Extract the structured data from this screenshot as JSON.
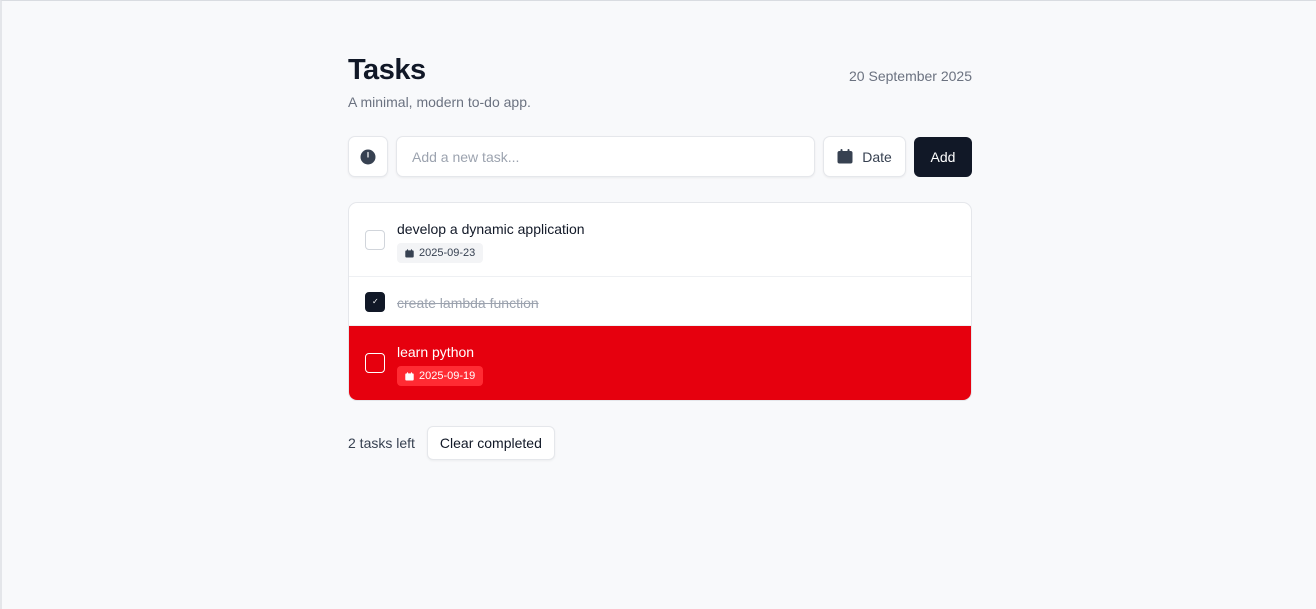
{
  "header": {
    "title": "Tasks",
    "subtitle": "A minimal, modern to-do app.",
    "today": "20 September 2025"
  },
  "composer": {
    "priority_icon": "clock-icon",
    "input_placeholder": "Add a new task...",
    "input_value": "",
    "date_label": "Date",
    "date_icon": "calendar-icon",
    "add_label": "Add"
  },
  "tasks": [
    {
      "text": "develop a dynamic application",
      "due": "2025-09-23",
      "done": false,
      "overdue": false
    },
    {
      "text": "create lambda function",
      "due": "",
      "done": true,
      "overdue": false
    },
    {
      "text": "learn python",
      "due": "2025-09-19",
      "done": false,
      "overdue": true
    }
  ],
  "footer": {
    "count_text": "2 tasks left",
    "clear_label": "Clear completed"
  },
  "colors": {
    "primary": "#111827",
    "overdue": "#e6000e",
    "overdue_badge": "#ff2b33"
  }
}
